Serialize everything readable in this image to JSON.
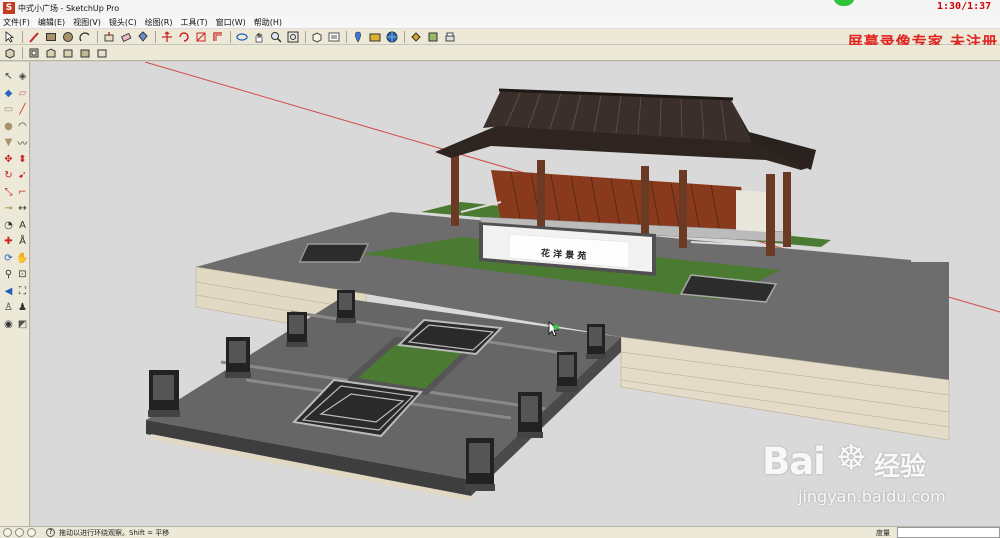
{
  "window": {
    "title": "中式小广场 - SketchUp Pro",
    "app_icon": "sketchup-icon",
    "clock": "1:30/1:37"
  },
  "menu": [
    "文件(F)",
    "编辑(E)",
    "视图(V)",
    "镜头(C)",
    "绘图(R)",
    "工具(T)",
    "窗口(W)",
    "帮助(H)"
  ],
  "toolbar": {
    "overlay_label": "屏幕录像专家  未注册",
    "top_icons": [
      "select-icon",
      "line-icon",
      "rectangle-icon",
      "circle-icon",
      "arc-icon",
      "push-pull-icon",
      "eraser-icon",
      "paint-bucket-icon",
      "move-icon",
      "rotate-icon",
      "scale-icon",
      "offset-icon",
      "orbit-icon",
      "pan-icon",
      "zoom-icon",
      "zoom-extents-icon",
      "component-icon",
      "outliner-icon",
      "geo-location-icon",
      "photo-textures-icon",
      "warehouse-icon",
      "share-model-icon",
      "extension-icon"
    ],
    "second_icons": [
      "iso-view-icon",
      "top-view-icon",
      "front-view-icon",
      "right-view-icon",
      "back-view-icon",
      "left-view-icon"
    ]
  },
  "left_toolbar": [
    "select-icon",
    "make-component-icon",
    "paint-bucket-icon",
    "eraser-icon",
    "rectangle-icon",
    "line-icon",
    "circle-icon",
    "arc-icon",
    "polygon-icon",
    "freehand-icon",
    "move-icon",
    "push-pull-icon",
    "rotate-icon",
    "follow-me-icon",
    "scale-icon",
    "offset-icon",
    "tape-measure-icon",
    "dimension-icon",
    "protractor-icon",
    "text-icon",
    "axes-icon",
    "3d-text-icon",
    "orbit-icon",
    "pan-icon",
    "zoom-icon",
    "zoom-window-icon",
    "previous-view-icon",
    "zoom-extents-icon",
    "position-camera-icon",
    "walk-icon",
    "look-around-icon",
    "section-plane-icon"
  ],
  "scene": {
    "plaque_text": "花 洋 景 苑",
    "colors": {
      "background": "#d9d9d9",
      "paving": "#6a6a6a",
      "wall": "#e4dcc8",
      "roof": "#3a2f2a",
      "timber": "#6b3a24",
      "lawn": "#4b7a32",
      "axis_red": "#d24a4a"
    }
  },
  "status": {
    "text": "拖动以进行环绕观察。Shift = 平移",
    "measure_label": "度量",
    "measure_value": ""
  },
  "watermark": {
    "logo": "Bai",
    "brand": "经验",
    "url": "jingyan.baidu.com"
  }
}
